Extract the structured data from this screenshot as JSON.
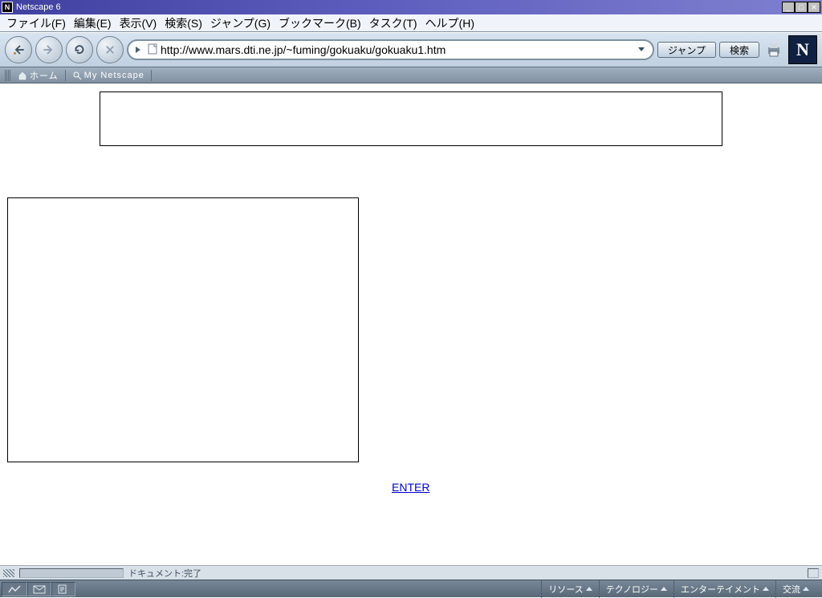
{
  "titlebar": {
    "app_name": "Netscape 6",
    "icon_letter": "N"
  },
  "menubar": {
    "items": [
      "ファイル(F)",
      "編集(E)",
      "表示(V)",
      "検索(S)",
      "ジャンプ(G)",
      "ブックマーク(B)",
      "タスク(T)",
      "ヘルプ(H)"
    ]
  },
  "navbar": {
    "url": "http://www.mars.dti.ne.jp/~fuming/gokuaku/gokuaku1.htm",
    "jump_label": "ジャンプ",
    "search_label": "検索",
    "logo_letter": "N"
  },
  "bookmarkbar": {
    "home_label": "ホーム",
    "mynetscape_label": "My Netscape"
  },
  "page": {
    "enter_text": "ENTER"
  },
  "statusbar": {
    "text": "ドキュメント:完了"
  },
  "taskbar": {
    "links": [
      "リソース",
      "テクノロジー",
      "エンターテイメント",
      "交流"
    ]
  }
}
